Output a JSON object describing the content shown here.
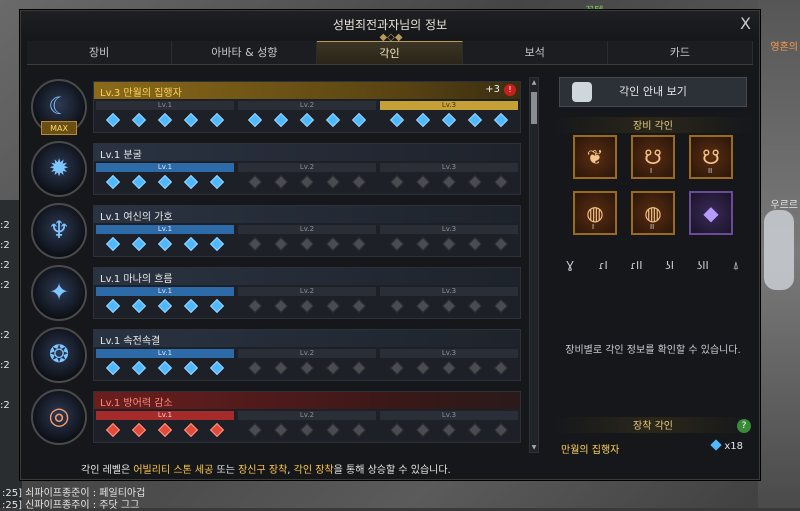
{
  "window": {
    "title": "성범죄전과자님의 정보",
    "close_label": "X"
  },
  "background": {
    "top_name": "꽃템",
    "side_text_1": "영혼의",
    "side_text_2": "우르르",
    "chat_lines": [
      ":2",
      ":2",
      ":2",
      ":2",
      ":2",
      ":2",
      ":2",
      ":25] 쇠파이프종준이 : 페일티아겁",
      ":25] 신파이프종주이 : 주닷 그그"
    ]
  },
  "tabs": [
    {
      "label": "장비",
      "active": false
    },
    {
      "label": "아바타 & 성향",
      "active": false
    },
    {
      "label": "각인",
      "active": true
    },
    {
      "label": "보석",
      "active": false
    },
    {
      "label": "카드",
      "active": false
    }
  ],
  "engravings": [
    {
      "name": "Lv.3 만월의 집행자",
      "style": "gold",
      "bonus": "+3",
      "alert": "!",
      "max_label": "MAX",
      "icon": "moon-icon",
      "active_level": 3,
      "gem_color": "blue",
      "levels": [
        "Lv.1",
        "Lv.2",
        "Lv.3"
      ]
    },
    {
      "name": "Lv.1 분굴",
      "style": "normal",
      "icon": "fire-icon",
      "active_level": 1,
      "gem_color": "blue",
      "levels": [
        "Lv.1",
        "Lv.2",
        "Lv.3"
      ]
    },
    {
      "name": "Lv.1 여신의 가호",
      "style": "normal",
      "icon": "goddess-icon",
      "active_level": 1,
      "gem_color": "blue",
      "levels": [
        "Lv.1",
        "Lv.2",
        "Lv.3"
      ]
    },
    {
      "name": "Lv.1 마나의 흐름",
      "style": "normal",
      "icon": "mana-icon",
      "active_level": 1,
      "gem_color": "blue",
      "levels": [
        "Lv.1",
        "Lv.2",
        "Lv.3"
      ]
    },
    {
      "name": "Lv.1 속전속결",
      "style": "normal",
      "icon": "speed-icon",
      "active_level": 1,
      "gem_color": "blue",
      "levels": [
        "Lv.1",
        "Lv.2",
        "Lv.3"
      ]
    },
    {
      "name": "Lv.1 방어력 감소",
      "style": "red",
      "icon": "shield-break-icon",
      "active_level": 1,
      "gem_color": "red",
      "levels": [
        "Lv.1",
        "Lv.2",
        "Lv.3"
      ]
    }
  ],
  "bottom_note": {
    "pre": "각인 레벨은 ",
    "hl1": "어빌리티 스톤 세공",
    "mid1": " 또는 ",
    "hl2": "장신구 장착",
    "mid2": ", ",
    "hl3": "각인 장착",
    "post": "을 통해 상승할 수 있습니다."
  },
  "right_panel": {
    "guide_button": "각인 안내 보기",
    "equip_engrave_header": "장비 각인",
    "slots": [
      {
        "icon": "necklace-icon",
        "tier": ""
      },
      {
        "icon": "earring-icon",
        "tier": "I"
      },
      {
        "icon": "earring-icon",
        "tier": "II"
      },
      {
        "icon": "ring-icon",
        "tier": "I"
      },
      {
        "icon": "ring-icon",
        "tier": "II"
      },
      {
        "icon": "stone-icon",
        "tier": ""
      }
    ],
    "filters": [
      "necklace-filter-icon",
      "earring1-filter-icon",
      "earring2-filter-icon",
      "ring1-filter-icon",
      "ring2-filter-icon",
      "stone-filter-icon"
    ],
    "info_text": "장비별로 각인 정보를 확인할 수 있습니다.",
    "equipped_header": "장착 각인",
    "help_label": "?",
    "equipped_name": "만월의 집행자",
    "equipped_count": "x18"
  },
  "colors": {
    "accent_gold": "#c4a037",
    "blue_gem": "#4fb8ff",
    "red_gem": "#e24a3a"
  }
}
